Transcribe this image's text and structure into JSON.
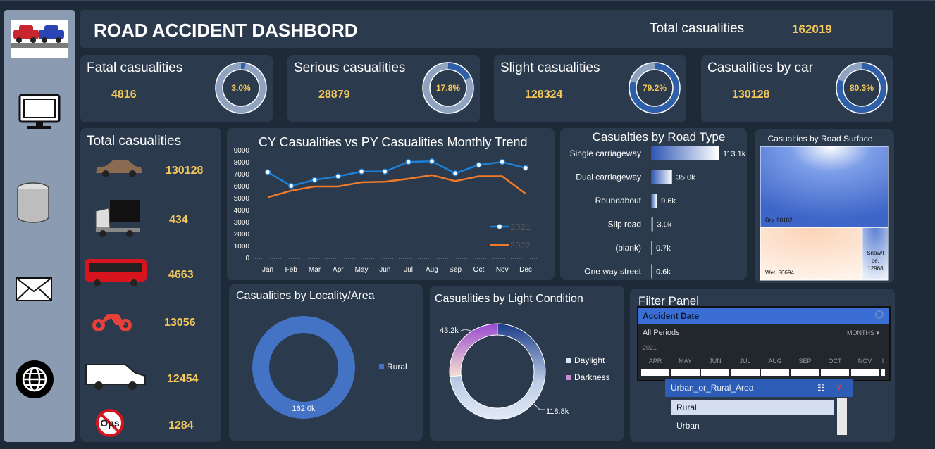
{
  "header": {
    "title": "ROAD ACCIDENT DASHBORD",
    "total_label": "Total casualities",
    "total_value": "162019"
  },
  "sidebar": {
    "icons": [
      "car-crash-icon",
      "monitor-icon",
      "database-icon",
      "mail-icon",
      "globe-icon"
    ]
  },
  "kpis": [
    {
      "title": "Fatal casualities",
      "value": "4816",
      "pct_label": "3.0%",
      "pct": 0.03
    },
    {
      "title": "Serious casualities",
      "value": "28879",
      "pct_label": "17.8%",
      "pct": 0.178
    },
    {
      "title": "Slight casualities",
      "value": "128324",
      "pct_label": "79.2%",
      "pct": 0.792
    },
    {
      "title": "Casualities  by car",
      "value": "130128",
      "pct_label": "80.3%",
      "pct": 0.803
    }
  ],
  "vehicles": {
    "title": "Total casualities",
    "items": [
      {
        "icon": "car-icon",
        "value": "130128"
      },
      {
        "icon": "truck-icon",
        "value": "434"
      },
      {
        "icon": "bus-icon",
        "value": "4663"
      },
      {
        "icon": "motorcycle-icon",
        "value": "13056"
      },
      {
        "icon": "van-icon",
        "value": "12454"
      },
      {
        "icon": "other-vehicle-icon",
        "value": "1284"
      }
    ]
  },
  "colors": {
    "cy_line": "#1f7fd4",
    "py_line": "#ee7a2a",
    "locality": "#4472c4",
    "accent": "#f4c85a",
    "ring_track": "#8fa3c0",
    "ring_fill": "#2f5fa8"
  },
  "chart_data": [
    {
      "type": "line",
      "title": "CY Casualities vs PY Casualities   Monthly Trend",
      "categories": [
        "Jan",
        "Feb",
        "Mar",
        "Apr",
        "May",
        "Jun",
        "Jul",
        "Aug",
        "Sep",
        "Oct",
        "Nov",
        "Dec"
      ],
      "series": [
        {
          "name": "2021",
          "values": [
            7200,
            6050,
            6550,
            6850,
            7250,
            7250,
            8050,
            8100,
            7100,
            7800,
            8050,
            7550
          ]
        },
        {
          "name": "2022",
          "values": [
            5100,
            5650,
            6000,
            6000,
            6350,
            6400,
            6650,
            6950,
            6450,
            6850,
            6850,
            5400
          ]
        }
      ],
      "yticks": [
        "0",
        "1000",
        "2000",
        "3000",
        "4000",
        "5000",
        "6000",
        "7000",
        "8000",
        "9000"
      ],
      "ylim": [
        0,
        9000
      ],
      "legend": "bottom-right",
      "grid": false
    },
    {
      "type": "bar",
      "title": "Casualties by Road Type",
      "categories": [
        "Single carriageway",
        "Dual carriageway",
        "Roundabout",
        "Slip road",
        "(blank)",
        "One way street"
      ],
      "values": [
        113.1,
        35.0,
        9.6,
        3.0,
        0.7,
        0.6
      ],
      "labels": [
        "113.1k",
        "35.0k",
        "9.6k",
        "3.0k",
        "0.7k",
        "0.6k"
      ]
    },
    {
      "type": "treemap",
      "title": "Casualties by Road Surface",
      "items": [
        {
          "label": "Dry, 98182",
          "value": 98182
        },
        {
          "label": "Wet, 50694",
          "value": 50694
        },
        {
          "label": "Snow/Ice, 12968",
          "value": 12968
        }
      ]
    },
    {
      "type": "pie",
      "title": "Casualities  by Locality/Area",
      "slices": [
        {
          "name": "Rural",
          "value": 162.0,
          "label": "162.0k"
        }
      ],
      "legend": "right"
    },
    {
      "type": "pie",
      "title": "Casualities  by Light Condition",
      "slices": [
        {
          "name": "Daylight",
          "value": 118.8,
          "label": "118.8k"
        },
        {
          "name": "Darkness",
          "value": 43.2,
          "label": "43.2k"
        }
      ],
      "legend": "right"
    }
  ],
  "filter": {
    "title": "Filter Panel",
    "timeline_header": "Accident Date",
    "periods_label": "All Periods",
    "granularity": "MONTHS",
    "year": "2021",
    "months": [
      "APR",
      "MAY",
      "JUN",
      "JUL",
      "AUG",
      "SEP",
      "OCT",
      "NOV",
      "I"
    ],
    "slicer_header": "Urban_or_Rural_Area",
    "slicer_items": [
      {
        "label": "Rural",
        "selected": true
      },
      {
        "label": "Urban",
        "selected": false
      }
    ]
  }
}
